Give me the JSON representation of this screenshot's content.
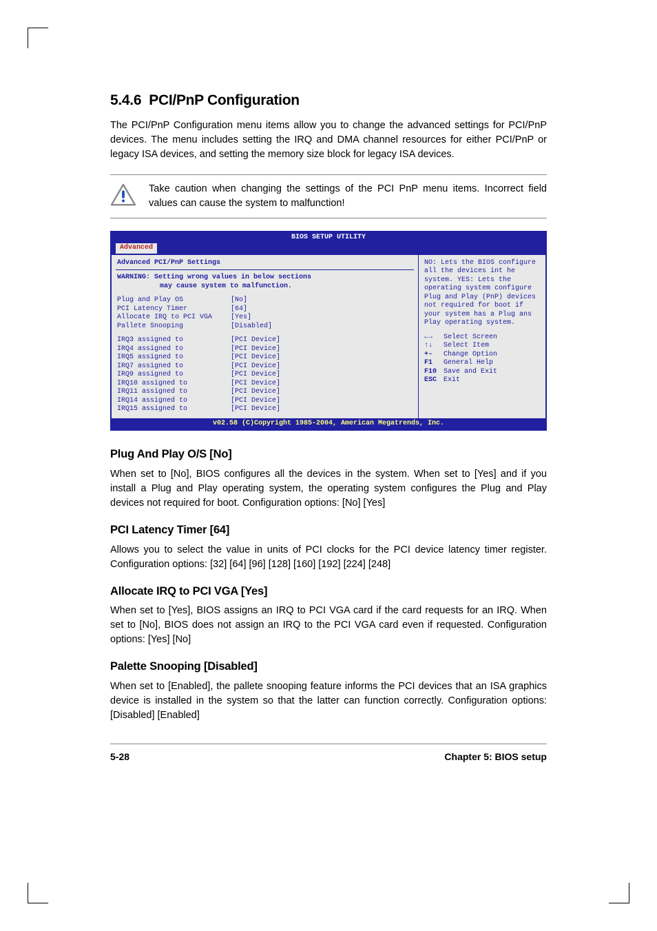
{
  "section": {
    "number": "5.4.6",
    "title": "PCI/PnP Configuration",
    "intro": "The PCI/PnP Configuration menu items allow you to change the advanced settings for PCI/PnP devices. The menu includes setting the IRQ and DMA channel resources for either PCI/PnP or legacy ISA devices, and setting the memory size block for legacy ISA devices.",
    "caution": "Take caution when changing the settings of the PCI PnP menu items. Incorrect field values can cause the system to malfunction!"
  },
  "bios": {
    "header": "BIOS SETUP UTILITY",
    "tab": "Advanced",
    "main_title": "Advanced PCI/PnP Settings",
    "warning_line1": "WARNING: Setting wrong values in below sections",
    "warning_line2": "may cause system to malfunction.",
    "settings": [
      {
        "label": "Plug and Play OS",
        "value": "[No]"
      },
      {
        "label": "PCI Latency Timer",
        "value": "[64]"
      },
      {
        "label": "Allocate IRQ to PCI VGA",
        "value": "[Yes]"
      },
      {
        "label": "Pallete Snooping",
        "value": "[Disabled]"
      }
    ],
    "irq_settings": [
      {
        "label": "IRQ3 assigned to",
        "value": "[PCI Device]"
      },
      {
        "label": "IRQ4 assigned to",
        "value": "[PCI Device]"
      },
      {
        "label": "IRQ5 assigned to",
        "value": "[PCI Device]"
      },
      {
        "label": "IRQ7 assigned to",
        "value": "[PCI Device]"
      },
      {
        "label": "IRQ9 assigned to",
        "value": "[PCI Device]"
      },
      {
        "label": "IRQ10 assigned to",
        "value": "[PCI Device]"
      },
      {
        "label": "IRQ11 assigned to",
        "value": "[PCI Device]"
      },
      {
        "label": "IRQ14 assigned to",
        "value": "[PCI Device]"
      },
      {
        "label": "IRQ15 assigned to",
        "value": "[PCI Device]"
      }
    ],
    "help_text": "NO: Lets the BIOS configure all the devices int he system. YES: Lets the operating system configure Plug and Play (PnP) devices not required for boot if your system has a Plug ans Play operating system.",
    "nav": [
      {
        "key": "←→",
        "label": "Select Screen"
      },
      {
        "key": "↑↓",
        "label": "Select Item"
      },
      {
        "key": "+-",
        "label": "Change Option"
      },
      {
        "key": "F1",
        "label": "General Help"
      },
      {
        "key": "F10",
        "label": "Save and Exit"
      },
      {
        "key": "ESC",
        "label": "Exit"
      }
    ],
    "footer": "v02.58 (C)Copyright 1985-2004, American Megatrends, Inc."
  },
  "subsections": [
    {
      "title": "Plug And Play O/S [No]",
      "text": "When set to [No], BIOS configures all the devices in the system. When set to [Yes] and if you install a Plug and Play operating system, the operating system configures the Plug and Play devices not required for boot. Configuration options: [No] [Yes]"
    },
    {
      "title": "PCI Latency Timer [64]",
      "text": "Allows you to select the value in units of PCI clocks for the PCI device latency timer register. Configuration options: [32] [64] [96] [128] [160] [192] [224] [248]"
    },
    {
      "title": "Allocate IRQ to PCI VGA [Yes]",
      "text": "When set to [Yes], BIOS assigns an IRQ to PCI VGA card if the card requests for an IRQ. When set to [No], BIOS does not assign an IRQ to the PCI VGA card even if requested. Configuration options: [Yes] [No]"
    },
    {
      "title": "Palette Snooping [Disabled]",
      "text": "When set to [Enabled], the pallete snooping feature informs the PCI devices that an ISA graphics device is installed in the system so that the latter can function correctly. Configuration options: [Disabled] [Enabled]"
    }
  ],
  "footer": {
    "page": "5-28",
    "chapter": "Chapter 5: BIOS setup"
  }
}
